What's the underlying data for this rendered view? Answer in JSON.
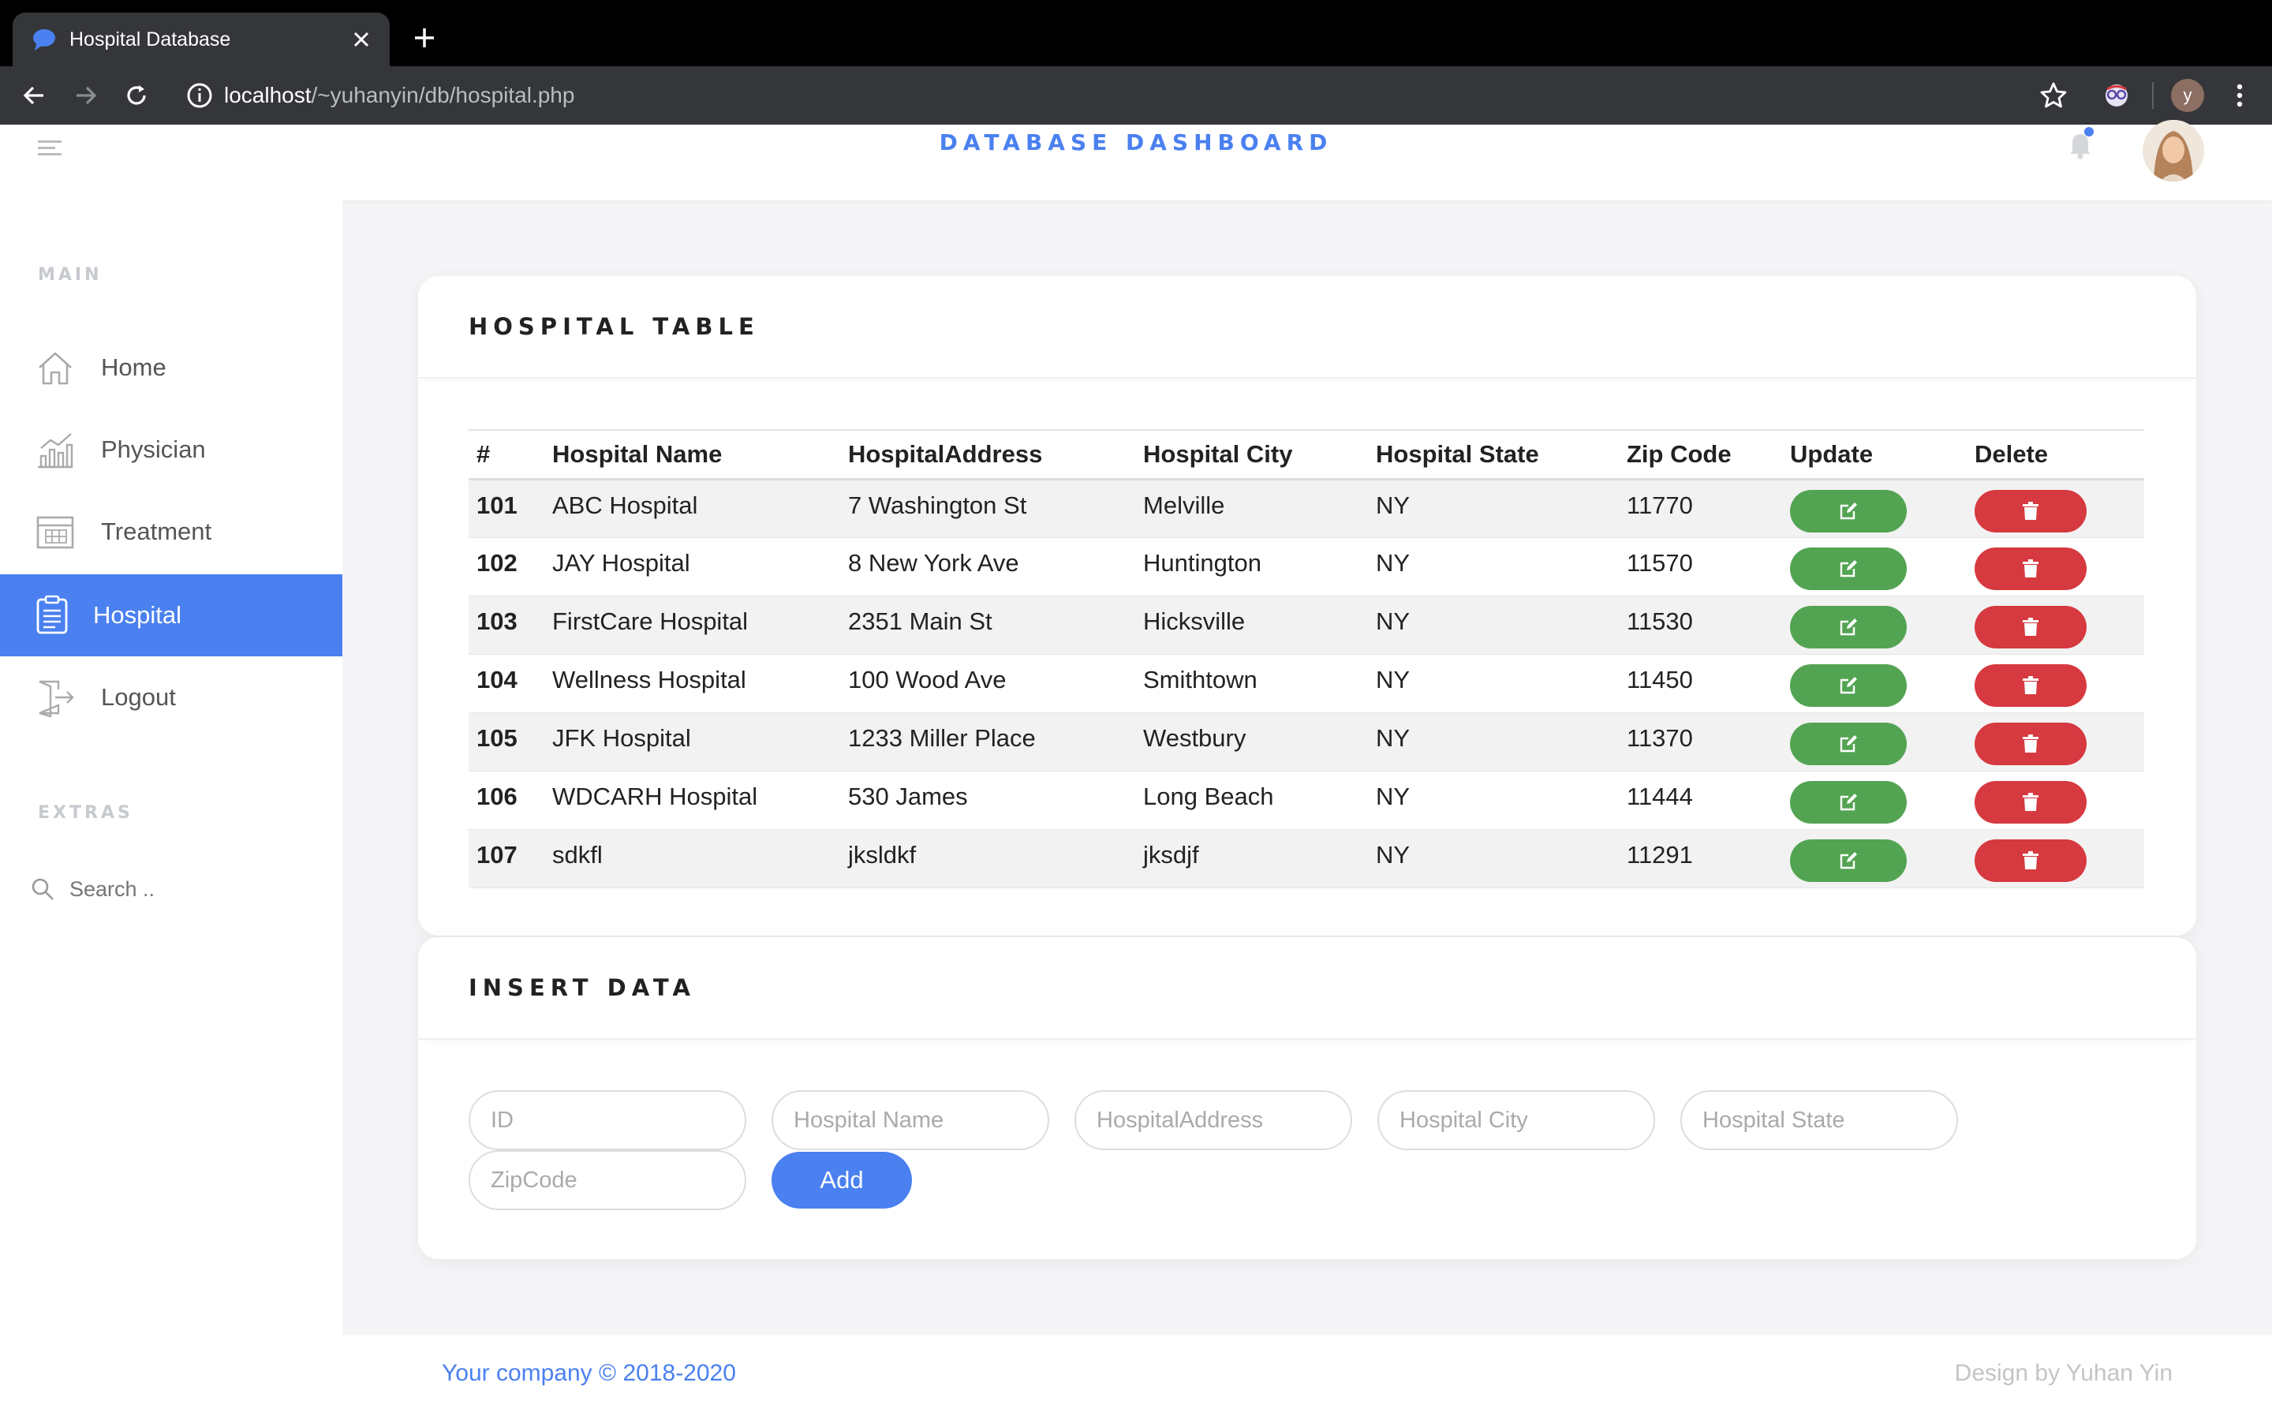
{
  "browser": {
    "tab_title": "Hospital Database",
    "url_host": "localhost",
    "url_path": "/~yuhanyin/db/hospital.php",
    "profile_initial": "y"
  },
  "header": {
    "title": "DATABASE DASHBOARD",
    "accent_color": "#4a80f0"
  },
  "sidebar": {
    "main_heading": "MAIN",
    "items": [
      {
        "label": "Home",
        "icon": "home-icon"
      },
      {
        "label": "Physician",
        "icon": "chart-icon"
      },
      {
        "label": "Treatment",
        "icon": "calendar-icon"
      },
      {
        "label": "Hospital",
        "icon": "clipboard-icon",
        "active": true
      },
      {
        "label": "Logout",
        "icon": "logout-icon"
      }
    ],
    "extras_heading": "EXTRAS",
    "search_placeholder": "Search .."
  },
  "hospital_table": {
    "title": "HOSPITAL TABLE",
    "columns": [
      "#",
      "Hospital Name",
      "HospitalAddress",
      "Hospital City",
      "Hospital State",
      "Zip Code",
      "Update",
      "Delete"
    ],
    "rows": [
      {
        "id": "101",
        "name": "ABC Hospital",
        "address": "7 Washington St",
        "city": "Melville",
        "state": "NY",
        "zip": "11770"
      },
      {
        "id": "102",
        "name": "JAY Hospital",
        "address": "8 New York Ave",
        "city": "Huntington",
        "state": "NY",
        "zip": "11570"
      },
      {
        "id": "103",
        "name": "FirstCare Hospital",
        "address": "2351 Main St",
        "city": "Hicksville",
        "state": "NY",
        "zip": "11530"
      },
      {
        "id": "104",
        "name": "Wellness Hospital",
        "address": "100 Wood Ave",
        "city": "Smithtown",
        "state": "NY",
        "zip": "11450"
      },
      {
        "id": "105",
        "name": "JFK Hospital",
        "address": "1233 Miller Place",
        "city": "Westbury",
        "state": "NY",
        "zip": "11370"
      },
      {
        "id": "106",
        "name": "WDCARH Hospital",
        "address": "530 James",
        "city": "Long Beach",
        "state": "NY",
        "zip": "11444"
      },
      {
        "id": "107",
        "name": "sdkfl",
        "address": "jksldkf",
        "city": "jksdjf",
        "state": "NY",
        "zip": "11291"
      }
    ],
    "update_color": "#53a452",
    "delete_color": "#d6393f"
  },
  "insert_form": {
    "title": "INSERT DATA",
    "placeholders": {
      "id": "ID",
      "name": "Hospital Name",
      "address": "HospitalAddress",
      "city": "Hospital City",
      "state": "Hospital State",
      "zip": "ZipCode"
    },
    "add_label": "Add"
  },
  "footer": {
    "left": "Your company © 2018-2020",
    "right": "Design by Yuhan Yin"
  }
}
